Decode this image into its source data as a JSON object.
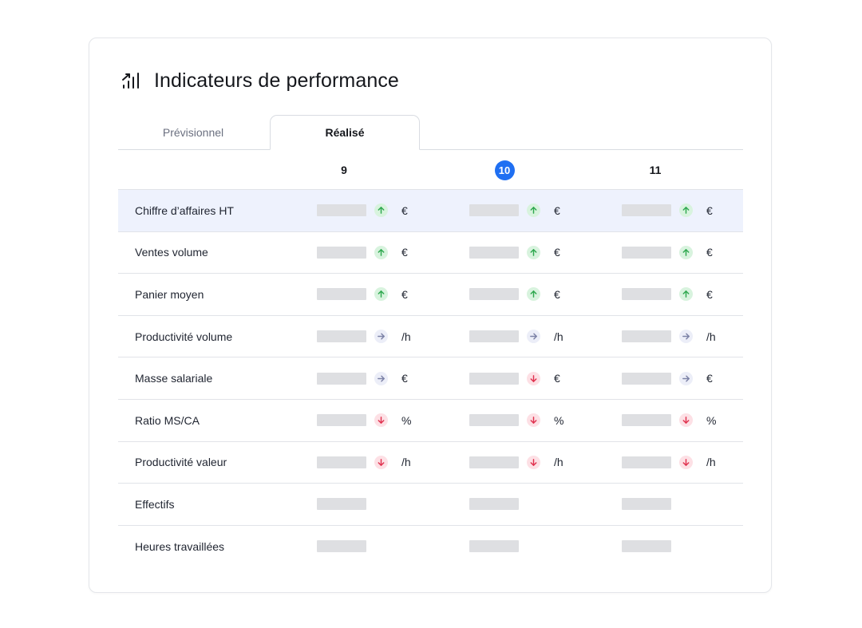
{
  "header": {
    "title": "Indicateurs de performance",
    "icon": "bar-chart-trend-icon"
  },
  "tabs": [
    {
      "label": "Prévisionnel",
      "active": false
    },
    {
      "label": "Réalisé",
      "active": true
    }
  ],
  "columns": [
    {
      "label": "9",
      "current": false
    },
    {
      "label": "10",
      "current": true
    },
    {
      "label": "11",
      "current": false
    }
  ],
  "rows": [
    {
      "label": "Chiffre d’affaires HT",
      "highlight": true,
      "cells": [
        {
          "trend": "up",
          "unit": "€"
        },
        {
          "trend": "up",
          "unit": "€"
        },
        {
          "trend": "up",
          "unit": "€"
        }
      ]
    },
    {
      "label": "Ventes volume",
      "highlight": false,
      "cells": [
        {
          "trend": "up",
          "unit": "€"
        },
        {
          "trend": "up",
          "unit": "€"
        },
        {
          "trend": "up",
          "unit": "€"
        }
      ]
    },
    {
      "label": "Panier moyen",
      "highlight": false,
      "cells": [
        {
          "trend": "up",
          "unit": "€"
        },
        {
          "trend": "up",
          "unit": "€"
        },
        {
          "trend": "up",
          "unit": "€"
        }
      ]
    },
    {
      "label": "Productivité volume",
      "highlight": false,
      "cells": [
        {
          "trend": "flat",
          "unit": "/h"
        },
        {
          "trend": "flat",
          "unit": "/h"
        },
        {
          "trend": "flat",
          "unit": "/h"
        }
      ]
    },
    {
      "label": "Masse salariale",
      "highlight": false,
      "cells": [
        {
          "trend": "flat",
          "unit": "€"
        },
        {
          "trend": "down",
          "unit": "€"
        },
        {
          "trend": "flat",
          "unit": "€"
        }
      ]
    },
    {
      "label": "Ratio MS/CA",
      "highlight": false,
      "cells": [
        {
          "trend": "down",
          "unit": "%"
        },
        {
          "trend": "down",
          "unit": "%"
        },
        {
          "trend": "down",
          "unit": "%"
        }
      ]
    },
    {
      "label": "Productivité valeur",
      "highlight": false,
      "cells": [
        {
          "trend": "down",
          "unit": "/h"
        },
        {
          "trend": "down",
          "unit": "/h"
        },
        {
          "trend": "down",
          "unit": "/h"
        }
      ]
    },
    {
      "label": "Effectifs",
      "highlight": false,
      "cells": [
        {
          "trend": null,
          "unit": ""
        },
        {
          "trend": null,
          "unit": ""
        },
        {
          "trend": null,
          "unit": ""
        }
      ]
    },
    {
      "label": "Heures travaillées",
      "highlight": false,
      "cells": [
        {
          "trend": null,
          "unit": ""
        },
        {
          "trend": null,
          "unit": ""
        },
        {
          "trend": null,
          "unit": ""
        }
      ]
    }
  ],
  "colors": {
    "accent": "#1f6ff2",
    "up": "#2fa84f",
    "down": "#e0324f",
    "flat": "#7c82a6",
    "highlight": "#eef2fd"
  }
}
